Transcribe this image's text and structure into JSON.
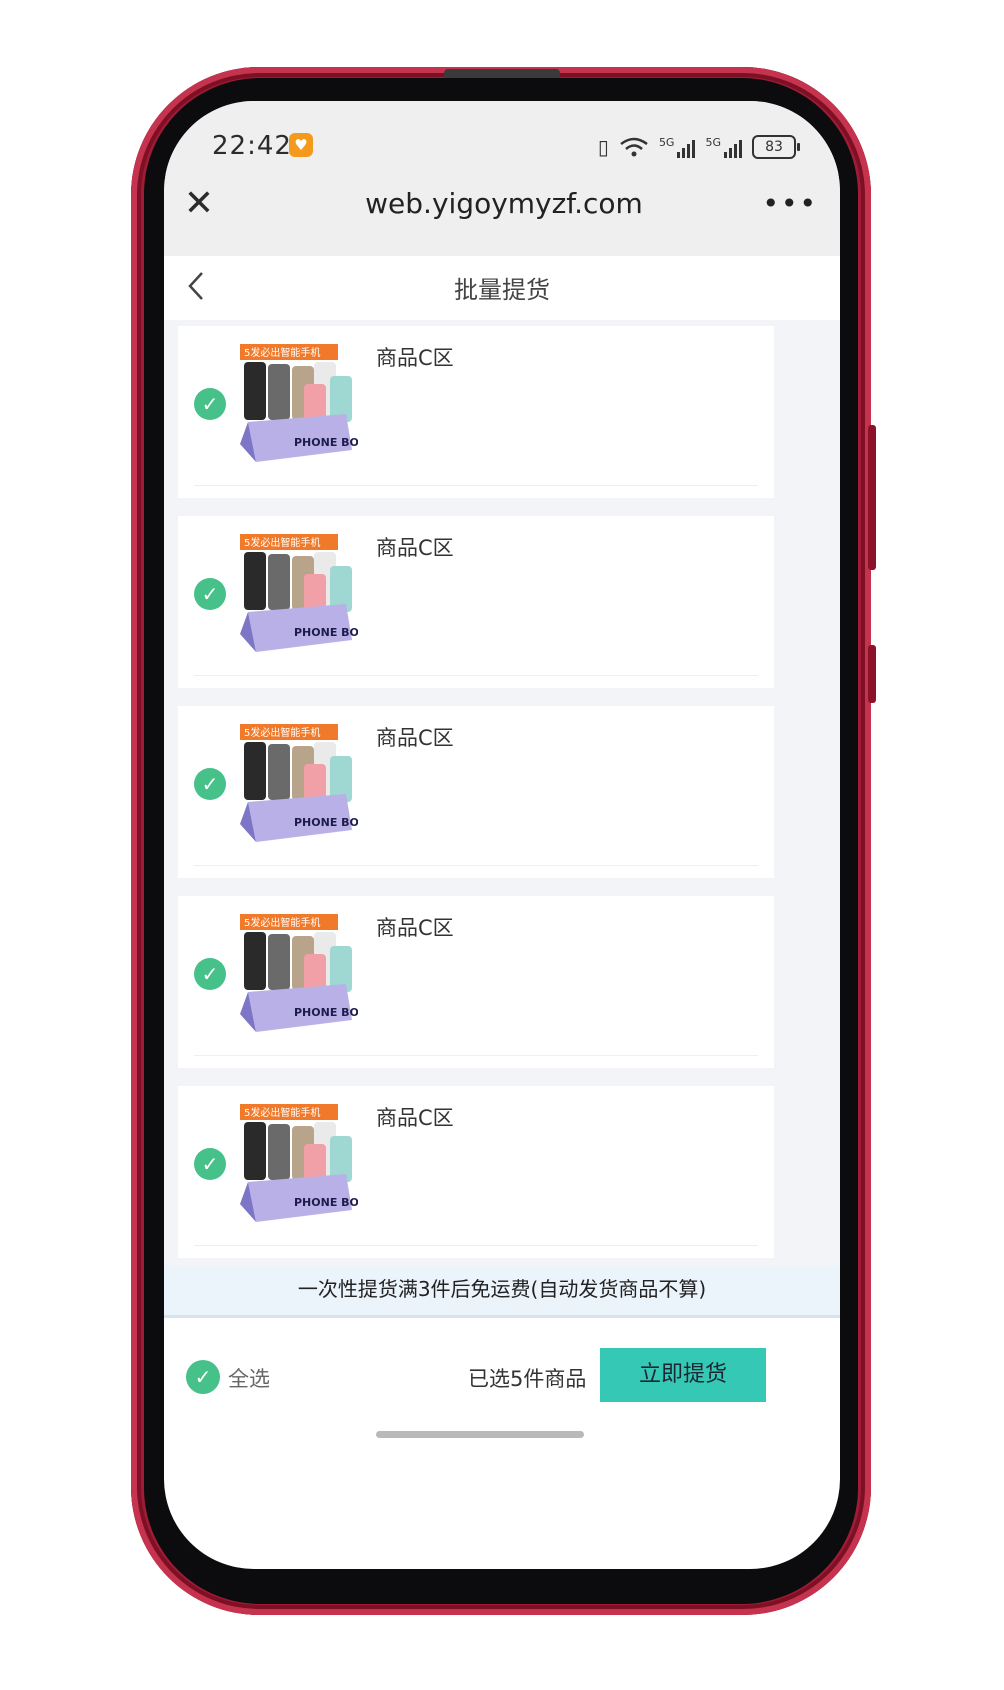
{
  "status_bar": {
    "time": "22:42",
    "vibrate_icon": "vibrate-icon",
    "wifi_icon": "wifi-icon",
    "signal_1_label": "5G",
    "signal_2_label": "5G",
    "battery": "83"
  },
  "browser": {
    "close_icon": "close-icon",
    "url": "web.yigoymyzf.com",
    "more_label": "•••"
  },
  "header": {
    "back_icon": "chevron-left-icon",
    "title": "批量提货"
  },
  "product_image": {
    "banner": "5发必出智能手机",
    "box_label": "PHONE BOX"
  },
  "items": [
    {
      "name": "商品C区",
      "checked": true
    },
    {
      "name": "商品C区",
      "checked": true
    },
    {
      "name": "商品C区",
      "checked": true
    },
    {
      "name": "商品C区",
      "checked": true
    },
    {
      "name": "商品C区",
      "checked": true
    }
  ],
  "notice": "一次性提货满3件后免运费(自动发货商品不算)",
  "footer": {
    "select_all_label": "全选",
    "selected_text": "已选5件商品",
    "submit_label": "立即提货"
  },
  "colors": {
    "frame": "#9e1c35",
    "check_green": "#47c18a",
    "submit_teal": "#35c8b4",
    "notice_bg": "#ebf3fb"
  }
}
